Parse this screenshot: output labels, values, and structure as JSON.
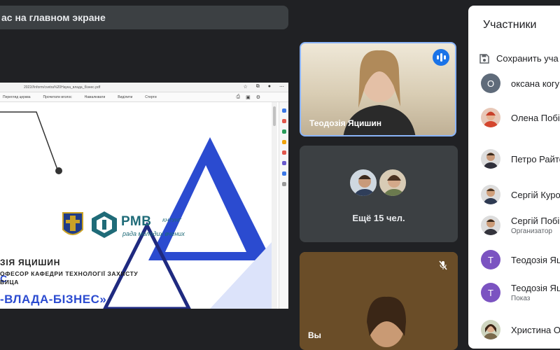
{
  "banner": {
    "text": "ас на главном экране"
  },
  "browser": {
    "url": "2022//Inform/cvetra%20Наука_влада_бізнес.pdf",
    "toolbar": [
      "Перегляд церква",
      "Прочитати вголос",
      "Намалювати",
      "Виділити",
      "Стерти"
    ]
  },
  "slide": {
    "rmv_title": "РМВ",
    "rmv_sub1": "КНТУНГ",
    "rmv_sub2": "рада молодих вчених",
    "heading_start": "С",
    "heading": "-ВЛАДА-БІЗНЕС»",
    "name": "ЗІЯ ЯЦИШИН",
    "role": "ОФЕСОР КАФЕДРИ ТЕХНОЛОГІЇ ЗАХИСТУ",
    "city": "ВИЦА"
  },
  "tiles": {
    "speaker_name": "Теодозія Яцишин",
    "more_label": "Ещё 15 чел.",
    "self_name": "Вы"
  },
  "panel": {
    "title": "Участники",
    "save_label": "Сохранить уча",
    "participants": [
      {
        "name": "оксана когу",
        "sub": "",
        "initial": "O",
        "color": "#5f6b7a"
      },
      {
        "name": "Олена Побі",
        "sub": "",
        "initial": "",
        "color": "#d9a089"
      },
      {
        "name": "Петро Райте",
        "sub": "",
        "initial": "",
        "color": "#8a6a55"
      },
      {
        "name": "Сергій Куро",
        "sub": "",
        "initial": "",
        "color": "#7e6a5c"
      },
      {
        "name": "Сергій Побі",
        "sub": "Организатор",
        "initial": "",
        "color": "#6e5a4c"
      },
      {
        "name": "Теодозія Яц",
        "sub": "",
        "initial": "T",
        "color": "#7b53c1"
      },
      {
        "name": "Теодозія Яц",
        "sub": "Показ",
        "initial": "T",
        "color": "#7b53c1"
      },
      {
        "name": "Христина О",
        "sub": "",
        "initial": "",
        "color": "#7a8a5c"
      }
    ]
  }
}
